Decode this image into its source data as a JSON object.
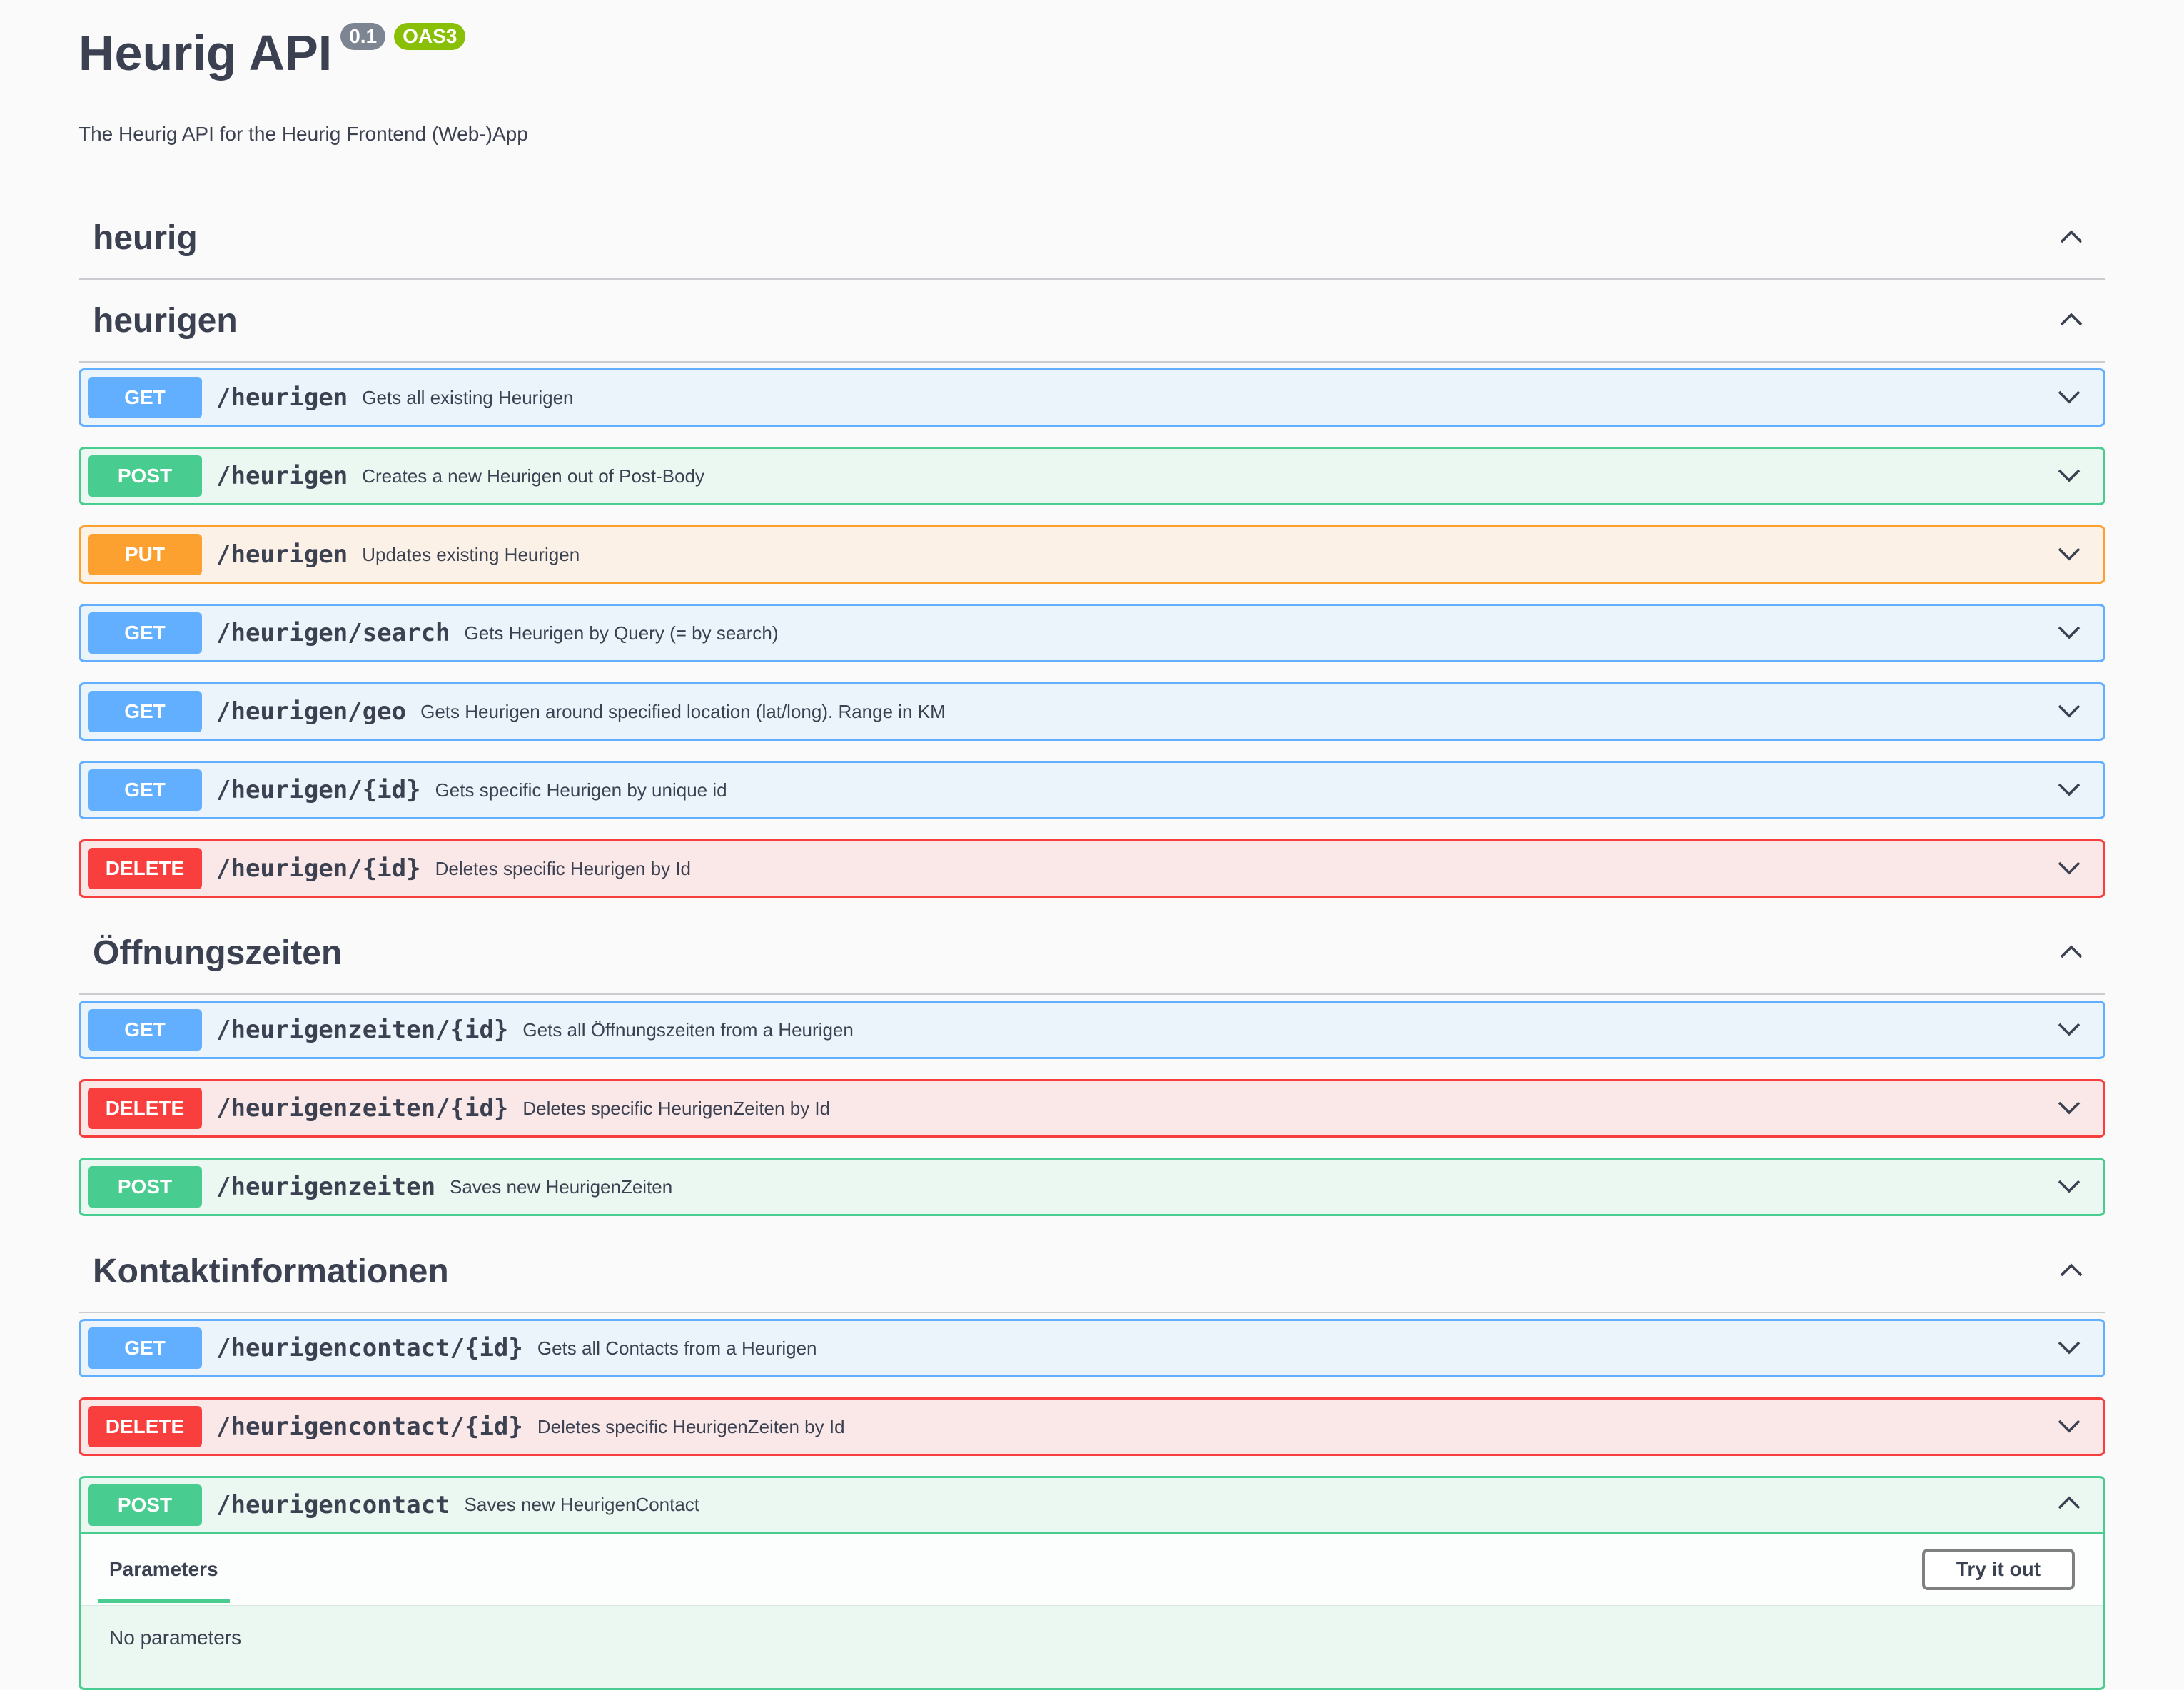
{
  "info": {
    "title": "Heurig API",
    "version": "0.1",
    "oas": "OAS3",
    "description": "The Heurig API for the Heurig Frontend (Web-)App"
  },
  "tags": [
    {
      "name": "heurig"
    },
    {
      "name": "heurigen"
    },
    {
      "name": "Öffnungszeiten"
    },
    {
      "name": "Kontaktinformationen"
    }
  ],
  "operations": [
    {
      "method": "GET",
      "path": "/heurigen",
      "summary": "Gets all existing Heurigen"
    },
    {
      "method": "POST",
      "path": "/heurigen",
      "summary": "Creates a new Heurigen out of Post-Body"
    },
    {
      "method": "PUT",
      "path": "/heurigen",
      "summary": "Updates existing Heurigen"
    },
    {
      "method": "GET",
      "path": "/heurigen/search",
      "summary": "Gets Heurigen by Query (= by search)"
    },
    {
      "method": "GET",
      "path": "/heurigen/geo",
      "summary": "Gets Heurigen around specified location (lat/long). Range in KM"
    },
    {
      "method": "GET",
      "path": "/heurigen/{id}",
      "summary": "Gets specific Heurigen by unique id"
    },
    {
      "method": "DELETE",
      "path": "/heurigen/{id}",
      "summary": "Deletes specific Heurigen by Id"
    },
    {
      "method": "GET",
      "path": "/heurigenzeiten/{id}",
      "summary": "Gets all Öffnungszeiten from a Heurigen"
    },
    {
      "method": "DELETE",
      "path": "/heurigenzeiten/{id}",
      "summary": "Deletes specific HeurigenZeiten by Id"
    },
    {
      "method": "POST",
      "path": "/heurigenzeiten",
      "summary": "Saves new HeurigenZeiten"
    },
    {
      "method": "GET",
      "path": "/heurigencontact/{id}",
      "summary": "Gets all Contacts from a Heurigen"
    },
    {
      "method": "DELETE",
      "path": "/heurigencontact/{id}",
      "summary": "Deletes specific HeurigenZeiten by Id"
    },
    {
      "method": "POST",
      "path": "/heurigencontact",
      "summary": "Saves new HeurigenContact"
    }
  ],
  "expanded": {
    "parameters_tab": "Parameters",
    "try_button": "Try it out",
    "no_params": "No parameters"
  },
  "colors": {
    "get": "#61affe",
    "post": "#49cc90",
    "put": "#fca130",
    "delete": "#f93e3e"
  }
}
